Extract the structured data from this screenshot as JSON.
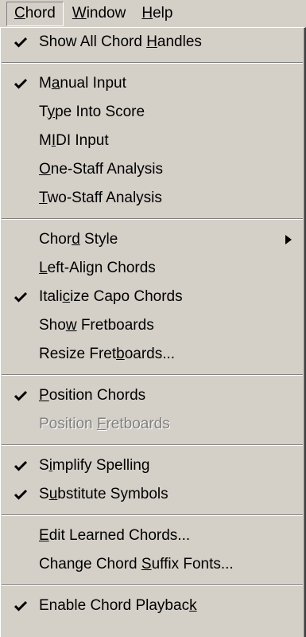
{
  "menubar": {
    "items": [
      {
        "pre": "",
        "key": "C",
        "post": "hord"
      },
      {
        "pre": "",
        "key": "W",
        "post": "indow"
      },
      {
        "pre": "",
        "key": "H",
        "post": "elp"
      }
    ]
  },
  "menu": {
    "items": [
      {
        "pre": "Show All Chord ",
        "key": "H",
        "post": "andles",
        "checked": true
      },
      {
        "pre": "M",
        "key": "a",
        "post": "nual Input",
        "checked": true
      },
      {
        "pre": "T",
        "key": "y",
        "post": "pe Into Score",
        "checked": false
      },
      {
        "pre": "M",
        "key": "I",
        "post": "DI Input",
        "checked": false
      },
      {
        "pre": "",
        "key": "O",
        "post": "ne-Staff Analysis",
        "checked": false
      },
      {
        "pre": "",
        "key": "T",
        "post": "wo-Staff Analysis",
        "checked": false
      },
      {
        "pre": "Chor",
        "key": "d",
        "post": " Style",
        "checked": false
      },
      {
        "pre": "",
        "key": "L",
        "post": "eft-Align Chords",
        "checked": false
      },
      {
        "pre": "Itali",
        "key": "c",
        "post": "ize Capo Chords",
        "checked": true
      },
      {
        "pre": "Sho",
        "key": "w",
        "post": " Fretboards",
        "checked": false
      },
      {
        "pre": "Resize Fret",
        "key": "b",
        "post": "oards...",
        "checked": false
      },
      {
        "pre": "",
        "key": "P",
        "post": "osition Chords",
        "checked": true
      },
      {
        "pre": "Position ",
        "key": "F",
        "post": "retboards",
        "checked": false
      },
      {
        "pre": "S",
        "key": "i",
        "post": "mplify Spelling",
        "checked": true
      },
      {
        "pre": "S",
        "key": "u",
        "post": "bstitute Symbols",
        "checked": true
      },
      {
        "pre": "",
        "key": "E",
        "post": "dit Learned Chords...",
        "checked": false
      },
      {
        "pre": "Change Chord ",
        "key": "S",
        "post": "uffix Fonts...",
        "checked": false
      },
      {
        "pre": "Enable Chord Playbac",
        "key": "k",
        "post": "",
        "checked": true
      }
    ]
  },
  "icons": {
    "check": "checkmark-icon",
    "submenu": "submenu-arrow-icon"
  }
}
